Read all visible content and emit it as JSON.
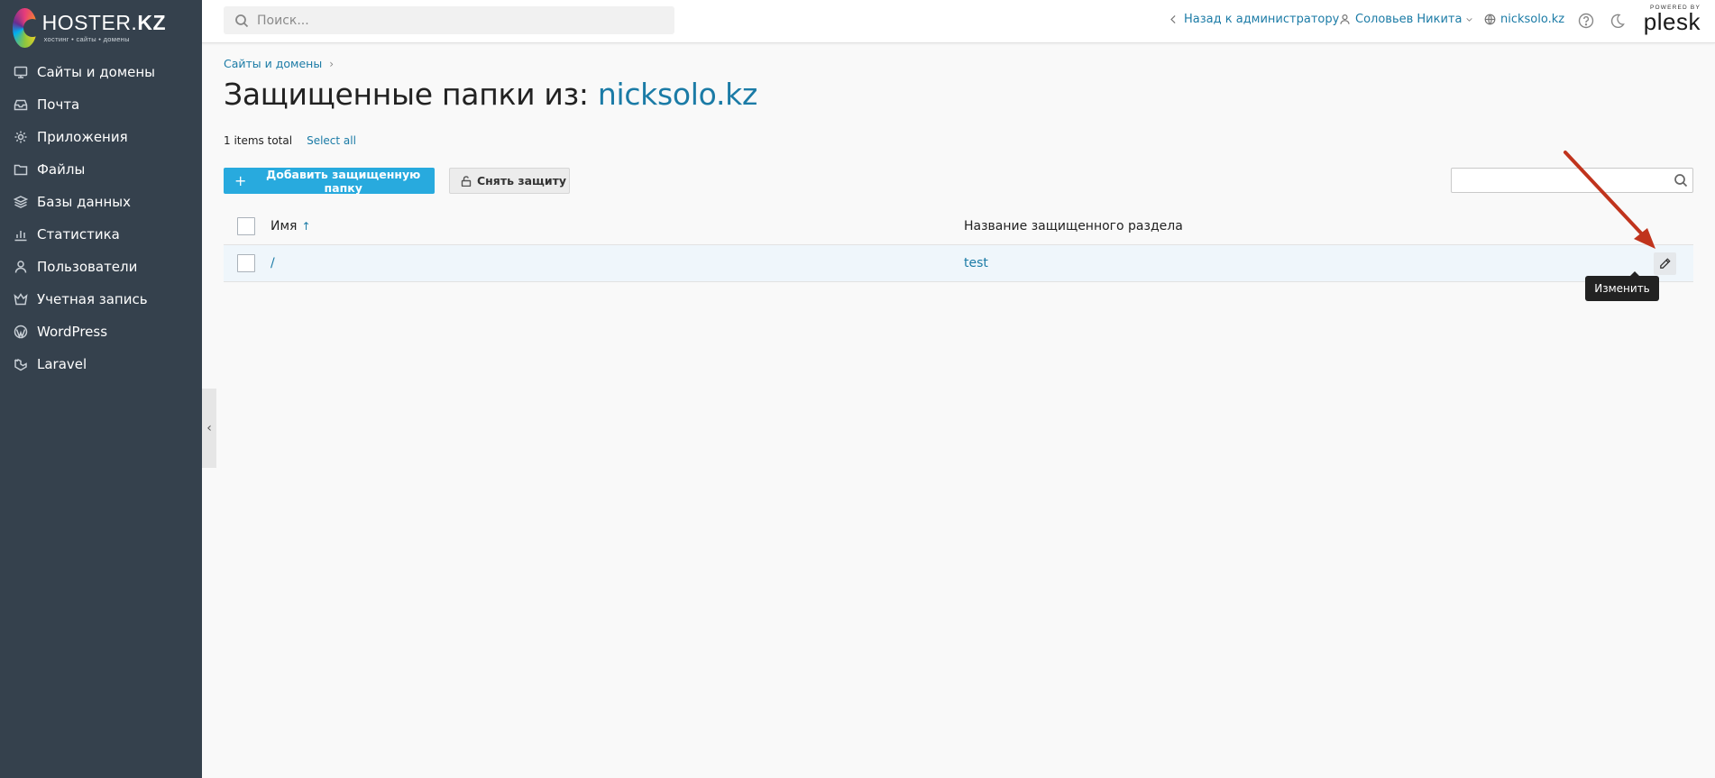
{
  "brand": {
    "name_regular": "HOSTER.",
    "name_bold": "KZ",
    "tagline": "хостинг • сайты • домены"
  },
  "sidebar": {
    "items": [
      {
        "label": "Сайты и домены",
        "icon": "monitor-icon"
      },
      {
        "label": "Почта",
        "icon": "mail-icon"
      },
      {
        "label": "Приложения",
        "icon": "gear-icon"
      },
      {
        "label": "Файлы",
        "icon": "folder-icon"
      },
      {
        "label": "Базы данных",
        "icon": "database-layers-icon"
      },
      {
        "label": "Статистика",
        "icon": "bar-chart-icon"
      },
      {
        "label": "Пользователи",
        "icon": "user-icon"
      },
      {
        "label": "Учетная запись",
        "icon": "account-crown-icon"
      },
      {
        "label": "WordPress",
        "icon": "wordpress-icon"
      },
      {
        "label": "Laravel",
        "icon": "laravel-icon"
      }
    ],
    "collapse_glyph": "‹"
  },
  "header": {
    "search_placeholder": "Поиск...",
    "back_label": "Назад к администратору",
    "user_label": "Соловьев Никита",
    "domain_label": "nicksolo.kz",
    "powered_by": "POWERED BY",
    "plesk": "plesk"
  },
  "page": {
    "breadcrumb": "Сайты и домены",
    "title_prefix": "Защищенные папки из: ",
    "title_domain": "nicksolo.kz",
    "items_total": "1 items total",
    "select_all": "Select all"
  },
  "toolbar": {
    "add_label": "Добавить защищенную папку",
    "remove_label": "Снять защиту",
    "search_value": ""
  },
  "table": {
    "columns": [
      "Имя",
      "Название защищенного раздела"
    ],
    "sort_glyph": "↑",
    "rows": [
      {
        "name": "/",
        "realm": "test"
      }
    ]
  },
  "tooltip": {
    "edit": "Изменить"
  },
  "colors": {
    "sidebar_bg": "#35414d",
    "link": "#1b7ba6",
    "primary_button": "#28aade",
    "annotation_arrow": "#c0341d"
  }
}
